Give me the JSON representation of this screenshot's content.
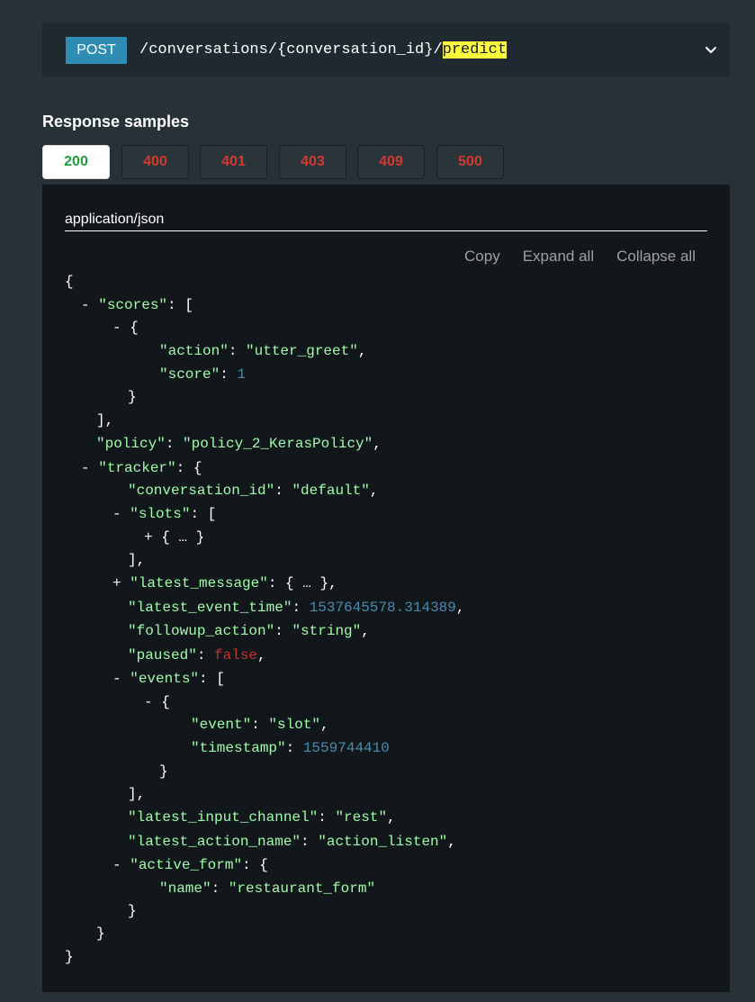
{
  "endpoint": {
    "method": "POST",
    "path_prefix": "/conversations/{conversation_id}/",
    "path_highlight": "predict",
    "expand_icon": "chevron-down-icon"
  },
  "response_samples": {
    "title": "Response samples",
    "selected_status": "200",
    "tabs": [
      {
        "label": "200",
        "color": "#1e9e3a"
      },
      {
        "label": "400",
        "color": "#d23a2f"
      },
      {
        "label": "401",
        "color": "#d23a2f"
      },
      {
        "label": "403",
        "color": "#d23a2f"
      },
      {
        "label": "409",
        "color": "#d23a2f"
      },
      {
        "label": "500",
        "color": "#d23a2f"
      }
    ],
    "content_type": "application/json",
    "actions": {
      "copy": "Copy",
      "expand_all": "Expand all",
      "collapse_all": "Collapse all"
    },
    "json_lines": [
      {
        "indent": 0,
        "tokens": [
          {
            "t": "p",
            "v": "{"
          }
        ]
      },
      {
        "indent": 1,
        "tokens": [
          {
            "t": "toggle",
            "v": "-"
          },
          {
            "t": "p",
            "v": " "
          },
          {
            "t": "key",
            "v": "\"scores\""
          },
          {
            "t": "p",
            "v": ": ["
          }
        ]
      },
      {
        "indent": 3,
        "tokens": [
          {
            "t": "toggle",
            "v": "-"
          },
          {
            "t": "p",
            "v": " {"
          }
        ]
      },
      {
        "indent": 6,
        "tokens": [
          {
            "t": "key",
            "v": "\"action\""
          },
          {
            "t": "p",
            "v": ": "
          },
          {
            "t": "str",
            "v": "\"utter_greet\""
          },
          {
            "t": "p",
            "v": ","
          }
        ]
      },
      {
        "indent": 6,
        "tokens": [
          {
            "t": "key",
            "v": "\"score\""
          },
          {
            "t": "p",
            "v": ": "
          },
          {
            "t": "num",
            "v": "1"
          }
        ]
      },
      {
        "indent": 4,
        "tokens": [
          {
            "t": "p",
            "v": "}"
          }
        ]
      },
      {
        "indent": 2,
        "tokens": [
          {
            "t": "p",
            "v": "],"
          }
        ]
      },
      {
        "indent": 2,
        "tokens": [
          {
            "t": "key",
            "v": "\"policy\""
          },
          {
            "t": "p",
            "v": ": "
          },
          {
            "t": "str",
            "v": "\"policy_2_KerasPolicy\""
          },
          {
            "t": "p",
            "v": ","
          }
        ]
      },
      {
        "indent": 1,
        "tokens": [
          {
            "t": "toggle",
            "v": "-"
          },
          {
            "t": "p",
            "v": " "
          },
          {
            "t": "key",
            "v": "\"tracker\""
          },
          {
            "t": "p",
            "v": ": {"
          }
        ]
      },
      {
        "indent": 4,
        "tokens": [
          {
            "t": "key",
            "v": "\"conversation_id\""
          },
          {
            "t": "p",
            "v": ": "
          },
          {
            "t": "str",
            "v": "\"default\""
          },
          {
            "t": "p",
            "v": ","
          }
        ]
      },
      {
        "indent": 3,
        "tokens": [
          {
            "t": "toggle",
            "v": "-"
          },
          {
            "t": "p",
            "v": " "
          },
          {
            "t": "key",
            "v": "\"slots\""
          },
          {
            "t": "p",
            "v": ": ["
          }
        ]
      },
      {
        "indent": 5,
        "tokens": [
          {
            "t": "toggle",
            "v": "+"
          },
          {
            "t": "p",
            "v": " "
          },
          {
            "t": "ellipsis",
            "v": "{ … }"
          }
        ]
      },
      {
        "indent": 4,
        "tokens": [
          {
            "t": "p",
            "v": "],"
          }
        ]
      },
      {
        "indent": 3,
        "tokens": [
          {
            "t": "toggle",
            "v": "+"
          },
          {
            "t": "p",
            "v": " "
          },
          {
            "t": "key",
            "v": "\"latest_message\""
          },
          {
            "t": "p",
            "v": ": "
          },
          {
            "t": "ellipsis",
            "v": "{ … }"
          },
          {
            "t": "p",
            "v": ","
          }
        ]
      },
      {
        "indent": 4,
        "tokens": [
          {
            "t": "key",
            "v": "\"latest_event_time\""
          },
          {
            "t": "p",
            "v": ": "
          },
          {
            "t": "num",
            "v": "1537645578.314389"
          },
          {
            "t": "p",
            "v": ","
          }
        ]
      },
      {
        "indent": 4,
        "tokens": [
          {
            "t": "key",
            "v": "\"followup_action\""
          },
          {
            "t": "p",
            "v": ": "
          },
          {
            "t": "str",
            "v": "\"string\""
          },
          {
            "t": "p",
            "v": ","
          }
        ]
      },
      {
        "indent": 4,
        "tokens": [
          {
            "t": "key",
            "v": "\"paused\""
          },
          {
            "t": "p",
            "v": ": "
          },
          {
            "t": "bool",
            "v": "false"
          },
          {
            "t": "p",
            "v": ","
          }
        ]
      },
      {
        "indent": 3,
        "tokens": [
          {
            "t": "toggle",
            "v": "-"
          },
          {
            "t": "p",
            "v": " "
          },
          {
            "t": "key",
            "v": "\"events\""
          },
          {
            "t": "p",
            "v": ": ["
          }
        ]
      },
      {
        "indent": 5,
        "tokens": [
          {
            "t": "toggle",
            "v": "-"
          },
          {
            "t": "p",
            "v": " {"
          }
        ]
      },
      {
        "indent": 8,
        "tokens": [
          {
            "t": "key",
            "v": "\"event\""
          },
          {
            "t": "p",
            "v": ": "
          },
          {
            "t": "str",
            "v": "\"slot\""
          },
          {
            "t": "p",
            "v": ","
          }
        ]
      },
      {
        "indent": 8,
        "tokens": [
          {
            "t": "key",
            "v": "\"timestamp\""
          },
          {
            "t": "p",
            "v": ": "
          },
          {
            "t": "num",
            "v": "1559744410"
          }
        ]
      },
      {
        "indent": 6,
        "tokens": [
          {
            "t": "p",
            "v": "}"
          }
        ]
      },
      {
        "indent": 4,
        "tokens": [
          {
            "t": "p",
            "v": "],"
          }
        ]
      },
      {
        "indent": 4,
        "tokens": [
          {
            "t": "key",
            "v": "\"latest_input_channel\""
          },
          {
            "t": "p",
            "v": ": "
          },
          {
            "t": "str",
            "v": "\"rest\""
          },
          {
            "t": "p",
            "v": ","
          }
        ]
      },
      {
        "indent": 4,
        "tokens": [
          {
            "t": "key",
            "v": "\"latest_action_name\""
          },
          {
            "t": "p",
            "v": ": "
          },
          {
            "t": "str",
            "v": "\"action_listen\""
          },
          {
            "t": "p",
            "v": ","
          }
        ]
      },
      {
        "indent": 3,
        "tokens": [
          {
            "t": "toggle",
            "v": "-"
          },
          {
            "t": "p",
            "v": " "
          },
          {
            "t": "key",
            "v": "\"active_form\""
          },
          {
            "t": "p",
            "v": ": {"
          }
        ]
      },
      {
        "indent": 6,
        "tokens": [
          {
            "t": "key",
            "v": "\"name\""
          },
          {
            "t": "p",
            "v": ": "
          },
          {
            "t": "str",
            "v": "\"restaurant_form\""
          }
        ]
      },
      {
        "indent": 4,
        "tokens": [
          {
            "t": "p",
            "v": "}"
          }
        ]
      },
      {
        "indent": 2,
        "tokens": [
          {
            "t": "p",
            "v": "}"
          }
        ]
      },
      {
        "indent": 0,
        "tokens": [
          {
            "t": "p",
            "v": "}"
          }
        ]
      }
    ]
  }
}
